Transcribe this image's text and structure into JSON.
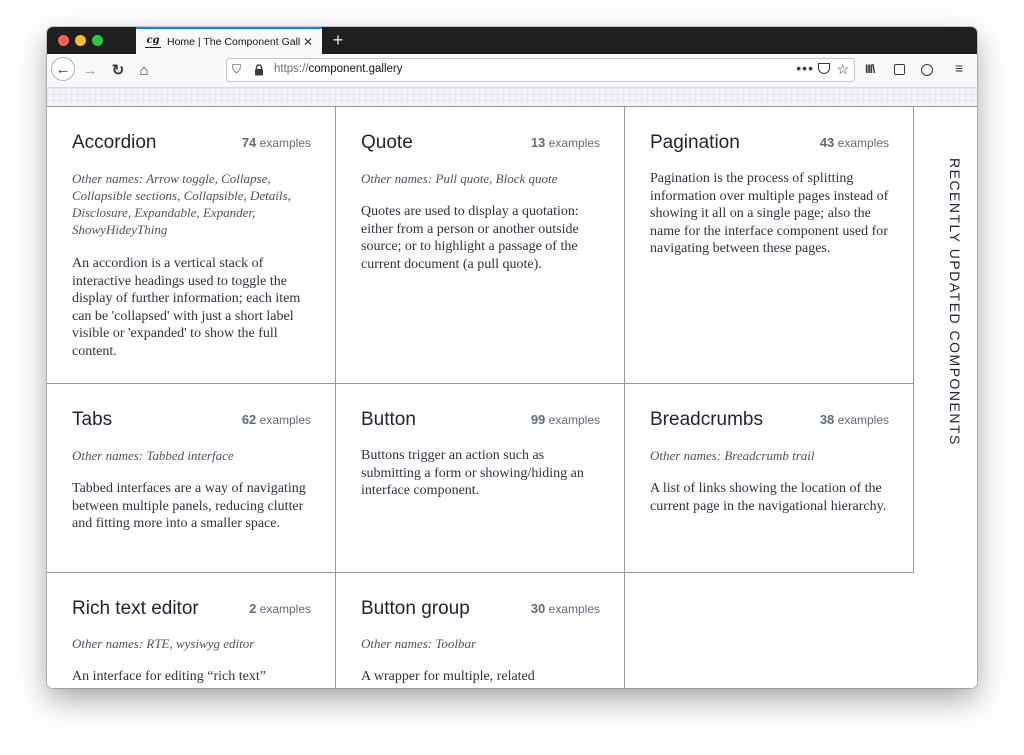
{
  "browser": {
    "tab_title": "Home | The Component Gallery",
    "favicon_text": "cg",
    "close_glyph": "✕",
    "new_tab_glyph": "+",
    "url_scheme": "https://",
    "url_host": "component.gallery",
    "page_actions_glyph": "•••",
    "back_glyph": "←",
    "forward_glyph": "→",
    "reload_glyph": "↻",
    "home_glyph": "⌂",
    "shield_glyph": "⛉",
    "star_glyph": "☆",
    "library_glyph": "III\\",
    "menu_glyph": "≡",
    "icons": [
      "back-icon",
      "forward-icon",
      "reload-icon",
      "home-icon",
      "shield-icon",
      "lock-icon",
      "page-actions-icon",
      "pocket-icon",
      "bookmark-star-icon",
      "library-icon",
      "sidebar-icon",
      "account-icon",
      "menu-icon"
    ]
  },
  "side_label": "RECENTLY UPDATED COMPONENTS",
  "components": [
    {
      "name": "Accordion",
      "count": "74",
      "count_suffix": "examples",
      "aliases": "Other names: Arrow toggle, Collapse, Collapsible sections, Collapsible, Details, Disclosure, Expandable, Expander, ShowyHideyThing",
      "description": "An accordion is a vertical stack of interactive headings used to toggle the display of further information; each item can be 'collapsed' with just a short label visible or 'expanded' to show the full content."
    },
    {
      "name": "Quote",
      "count": "13",
      "count_suffix": "examples",
      "aliases": "Other names: Pull quote, Block quote",
      "description": "Quotes are used to display a quotation: either from a person or another outside source; or to highlight a passage of the current document (a pull quote)."
    },
    {
      "name": "Pagination",
      "count": "43",
      "count_suffix": "examples",
      "aliases": "",
      "description": "Pagination is the process of splitting information over multiple pages instead of showing it all on a single page; also the name for the interface component used for navigating between these pages."
    },
    {
      "name": "Tabs",
      "count": "62",
      "count_suffix": "examples",
      "aliases": "Other names: Tabbed interface",
      "description": "Tabbed interfaces are a way of navigating between multiple panels, reducing clutter and fitting more into a smaller space."
    },
    {
      "name": "Button",
      "count": "99",
      "count_suffix": "examples",
      "aliases": "",
      "description": "Buttons trigger an action such as submitting a form or showing/hiding an interface component."
    },
    {
      "name": "Breadcrumbs",
      "count": "38",
      "count_suffix": "examples",
      "aliases": "Other names: Breadcrumb trail",
      "description": "A list of links showing the location of the current page in the navigational hierarchy."
    },
    {
      "name": "Rich text editor",
      "count": "2",
      "count_suffix": "examples",
      "aliases": "Other names: RTE, wysiwyg editor",
      "description": "An interface for editing “rich text”"
    },
    {
      "name": "Button group",
      "count": "30",
      "count_suffix": "examples",
      "aliases": "Other names: Toolbar",
      "description": "A wrapper for multiple, related"
    }
  ]
}
